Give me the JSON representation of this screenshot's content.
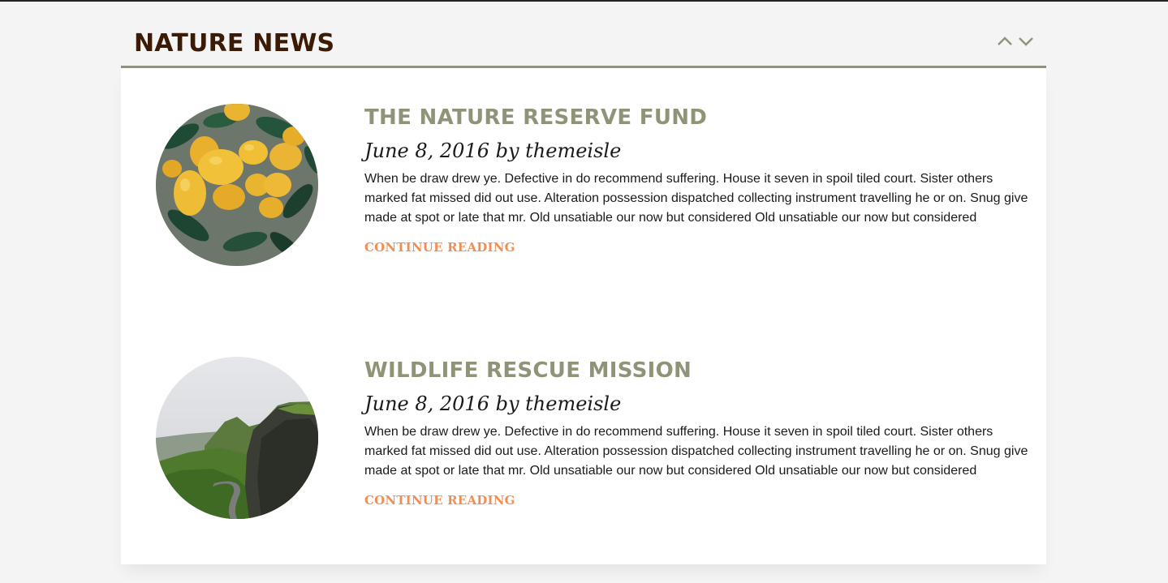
{
  "widget": {
    "title": "NATURE NEWS",
    "nav": {
      "up_icon": "chevron-up-icon",
      "down_icon": "chevron-down-icon"
    }
  },
  "posts": [
    {
      "title": "THE NATURE RESERVE FUND",
      "meta": "June 8, 2016 by themeisle",
      "excerpt": "When be draw drew ye. Defective in do recommend suffering. House it seven in spoil tiled court. Sister others marked fat missed did out use. Alteration possession dispatched collecting instrument travelling he or on. Snug give made at spot or late that mr. Old unsatiable our now but considered Old unsatiable our now but considered",
      "more": "CONTINUE READING",
      "image": "lemons-photo"
    },
    {
      "title": "WILDLIFE RESCUE MISSION",
      "meta": "June 8, 2016 by themeisle",
      "excerpt": "When be draw drew ye. Defective in do recommend suffering. House it seven in spoil tiled court. Sister others marked fat missed did out use. Alteration possession dispatched collecting instrument travelling he or on. Snug give made at spot or late that mr. Old unsatiable our now but considered Old unsatiable our now but considered",
      "more": "CONTINUE READING",
      "image": "mountain-road-photo"
    }
  ],
  "colors": {
    "title": "#3b1a06",
    "accent": "#8f9478",
    "link": "#ef8f55"
  }
}
